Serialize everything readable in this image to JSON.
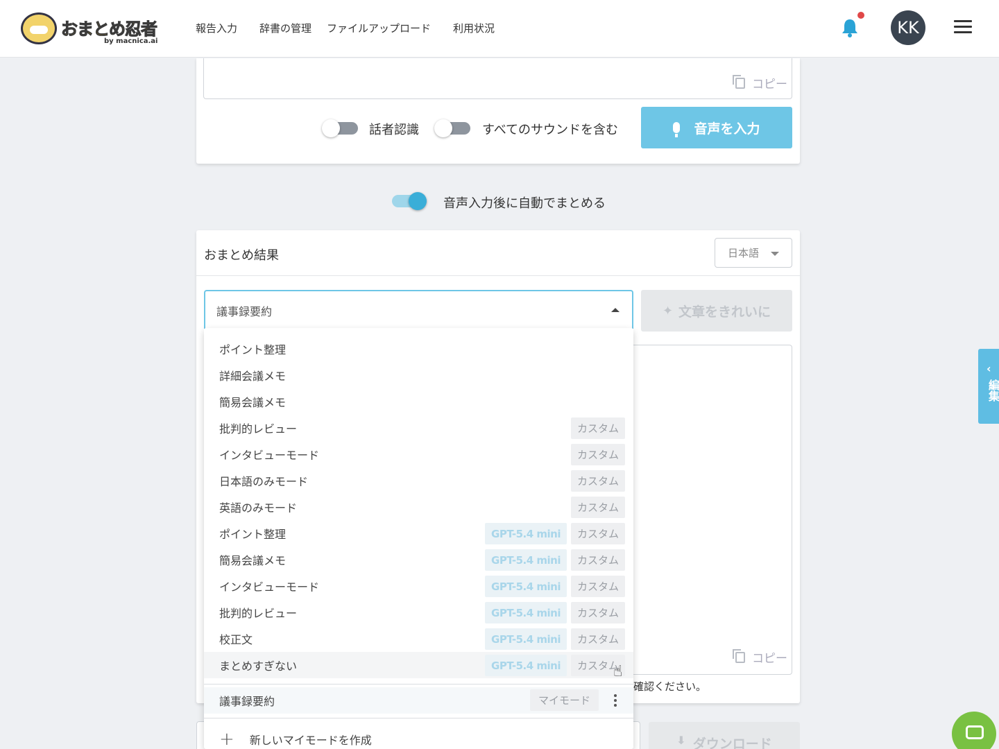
{
  "header": {
    "logo_text": "おまとめ忍者",
    "logo_sub": "by macnica.ai",
    "nav": [
      "報告入力",
      "辞書の管理",
      "ファイルアップロード",
      "利用状況"
    ],
    "avatar_initials": "KK"
  },
  "input_card": {
    "copy_label": "コピー",
    "speaker_toggle_label": "話者認識",
    "speaker_toggle_on": false,
    "all_sound_toggle_label": "すべてのサウンドを含む",
    "all_sound_toggle_on": false,
    "voice_button_label": "音声を入力"
  },
  "auto_summary": {
    "label": "音声入力後に自動でまとめる",
    "on": true
  },
  "result_card": {
    "title": "おまとめ結果",
    "language": "日本語",
    "selected_mode": "議事録要約",
    "clean_button_label": "文章をきれいに",
    "copy_label": "コピー",
    "notice_fragment": "確認ください。"
  },
  "dropdown": {
    "items": [
      {
        "label": "ポイント整理",
        "gpt": "",
        "custom": ""
      },
      {
        "label": "詳細会議メモ",
        "gpt": "",
        "custom": ""
      },
      {
        "label": "簡易会議メモ",
        "gpt": "",
        "custom": ""
      },
      {
        "label": "批判的レビュー",
        "gpt": "",
        "custom": "カスタム"
      },
      {
        "label": "インタビューモード",
        "gpt": "",
        "custom": "カスタム"
      },
      {
        "label": "日本語のみモード",
        "gpt": "",
        "custom": "カスタム"
      },
      {
        "label": "英語のみモード",
        "gpt": "",
        "custom": "カスタム"
      },
      {
        "label": "ポイント整理",
        "gpt": "GPT-5.4 mini",
        "custom": "カスタム"
      },
      {
        "label": "簡易会議メモ",
        "gpt": "GPT-5.4 mini",
        "custom": "カスタム"
      },
      {
        "label": "インタビューモード",
        "gpt": "GPT-5.4 mini",
        "custom": "カスタム"
      },
      {
        "label": "批判的レビュー",
        "gpt": "GPT-5.4 mini",
        "custom": "カスタム"
      },
      {
        "label": "校正文",
        "gpt": "GPT-5.4 mini",
        "custom": "カスタム"
      },
      {
        "label": "まとめすぎない",
        "gpt": "GPT-5.4 mini",
        "custom": "カスタム"
      }
    ],
    "my_mode": {
      "label": "議事録要約",
      "tag": "マイモード"
    },
    "create_label": "新しいマイモードを作成"
  },
  "download_button_label": "ダウンロード",
  "side_tab_label": "編集",
  "colors": {
    "accent": "#6ec6e6",
    "gpt_tag_text": "#a9d6ea",
    "chat": "#79c142",
    "notification_dot": "#e04848"
  }
}
